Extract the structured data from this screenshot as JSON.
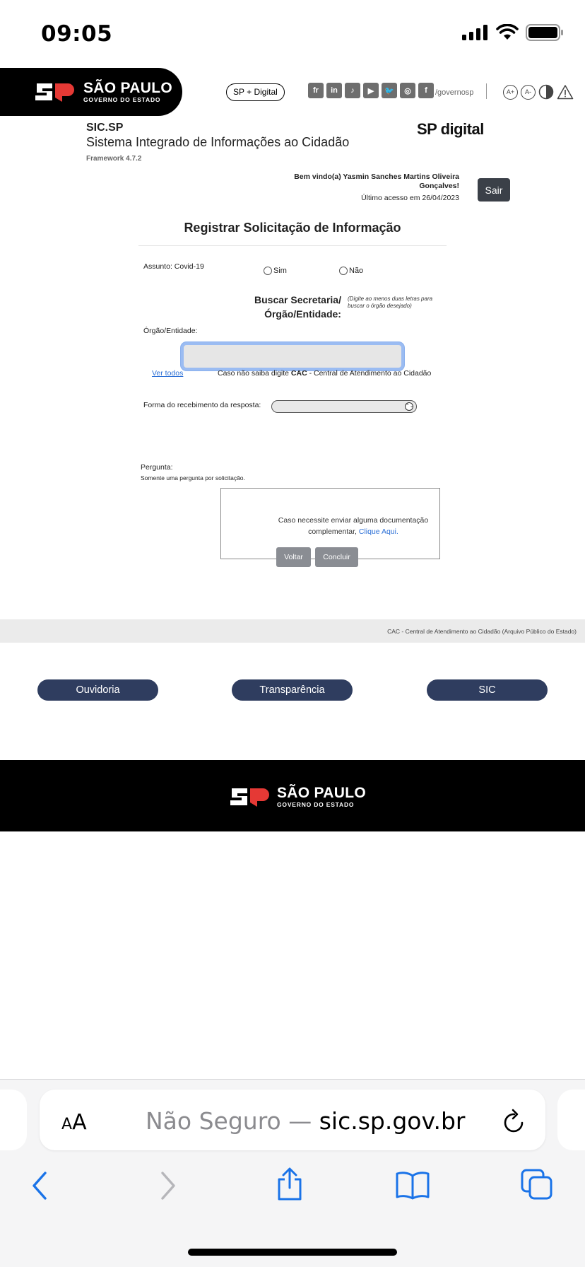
{
  "status_bar": {
    "time": "09:05"
  },
  "header": {
    "brand_line1": "SÃO PAULO",
    "brand_line2": "GOVERNO DO ESTADO",
    "sp_digital_link": "SP + Digital",
    "social_handle": "/governosp",
    "social_icons": [
      "flickr-icon",
      "linkedin-icon",
      "tiktok-icon",
      "youtube-icon",
      "twitter-icon",
      "instagram-icon",
      "facebook-icon"
    ],
    "accessibility": {
      "increase": "A+",
      "decrease": "A-"
    }
  },
  "system": {
    "acronym": "SIC.SP",
    "name": "Sistema Integrado de Informações ao Cidadão",
    "framework": "Framework 4.7.2",
    "logo_text": "SP digital"
  },
  "user": {
    "welcome_line1": "Bem vindo(a) Yasmin Sanches Martins Oliveira",
    "welcome_line2": "Gonçalves!",
    "last_access": "Último acesso em 26/04/2023",
    "logout_label": "Sair"
  },
  "form": {
    "heading": "Registrar Solicitação de Informação",
    "assunto_label": "Assunto: Covid-19",
    "radio_sim": "Sim",
    "radio_nao": "Não",
    "busca_line1": "Buscar Secretaria/",
    "busca_line2": "Órgão/Entidade:",
    "busca_hint": "(Digite ao menos duas letras para buscar o órgão desejado)",
    "orgao_label": "Órgão/Entidade:",
    "orgao_value": "",
    "ver_todos": "Ver todos",
    "cac_prefix": "Caso não saiba digite ",
    "cac_bold": "CAC",
    "cac_suffix": " - Central de Atendimento ao Cidadão",
    "forma_label": "Forma do recebimento da resposta:",
    "forma_value": "",
    "pergunta_label": "Pergunta:",
    "pergunta_hint": "Somente uma pergunta por solicitação.",
    "doc_text": "Caso necessite enviar alguma documentação complementar,",
    "doc_link": "Clique Aqui.",
    "voltar_label": "Voltar",
    "concluir_label": "Concluir"
  },
  "band": {
    "text": "CAC - Central de Atendimento ao Cidadão (Arquivo Público do Estado)"
  },
  "nav": {
    "ouvidoria": "Ouvidoria",
    "transparencia": "Transparência",
    "sic": "SIC"
  },
  "footer": {
    "brand_line1": "SÃO PAULO",
    "brand_line2": "GOVERNO DO ESTADO"
  },
  "safari": {
    "text_size_label": "AA",
    "insecure_label": "Não Seguro —",
    "domain": "sic.sp.gov.br"
  }
}
